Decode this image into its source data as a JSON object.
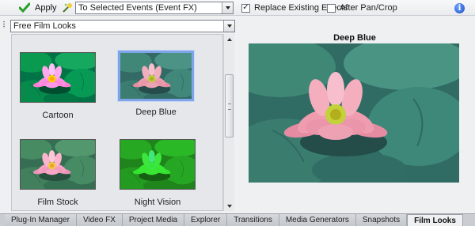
{
  "toolbar": {
    "apply_label": "Apply",
    "events_dropdown": "To Selected Events (Event FX)",
    "replace_label": "Replace Existing Effects",
    "replace_checked": true,
    "after_label": "After Pan/Crop",
    "after_checked": false,
    "info_icon": "i"
  },
  "preset_dropdown": "Free Film Looks",
  "thumbnails": [
    {
      "label": "Cartoon",
      "selected": false
    },
    {
      "label": "Deep Blue",
      "selected": true
    },
    {
      "label": "Film Stock",
      "selected": false
    },
    {
      "label": "Night Vision",
      "selected": false
    }
  ],
  "preview": {
    "title": "Deep Blue"
  },
  "tabs": [
    {
      "label": "Plug-In Manager",
      "active": false
    },
    {
      "label": "Video FX",
      "active": false
    },
    {
      "label": "Project Media",
      "active": false
    },
    {
      "label": "Explorer",
      "active": false
    },
    {
      "label": "Transitions",
      "active": false
    },
    {
      "label": "Media Generators",
      "active": false
    },
    {
      "label": "Snapshots",
      "active": false
    },
    {
      "label": "Film Looks",
      "active": true
    }
  ],
  "colors": {
    "accent": "#7fa5e8",
    "panel": "#e5e7ea",
    "tabbar": "#c9ccd1"
  },
  "icons": {
    "apply": "green-check-icon",
    "fx": "fx-wand-icon",
    "info": "info-icon"
  }
}
